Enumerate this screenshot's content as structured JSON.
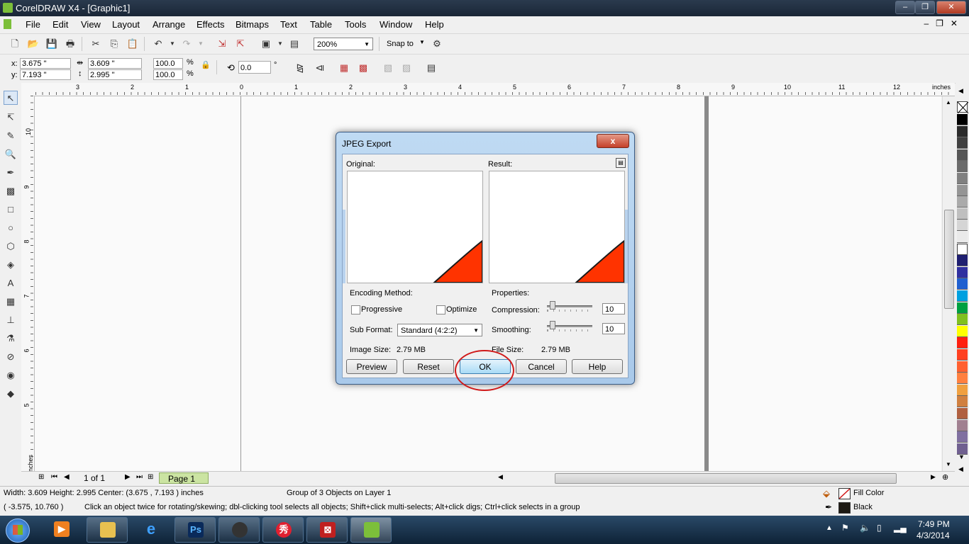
{
  "window": {
    "title": "CorelDRAW X4 - [Graphic1]"
  },
  "menu": [
    "File",
    "Edit",
    "View",
    "Layout",
    "Arrange",
    "Effects",
    "Bitmaps",
    "Text",
    "Table",
    "Tools",
    "Window",
    "Help"
  ],
  "toolbar": {
    "zoom": "200%",
    "snap_to": "Snap to"
  },
  "props": {
    "x_label": "x:",
    "x": "3.675 \"",
    "y_label": "y:",
    "y": "7.193 \"",
    "w": "3.609 \"",
    "h": "2.995 \"",
    "sx": "100.0",
    "sy": "100.0",
    "pct": "%",
    "rotation": "0.0",
    "deg": "°"
  },
  "rulers": {
    "h": [
      "3",
      "2",
      "1",
      "0",
      "1",
      "2",
      "3",
      "4",
      "5",
      "6",
      "7",
      "8",
      "9",
      "10",
      "11",
      "12"
    ],
    "unit": "inches",
    "v": [
      "10",
      "9",
      "8",
      "7",
      "6",
      "5"
    ],
    "v_unit": "inches"
  },
  "page_nav": {
    "count": "1 of 1",
    "tab": "Page 1"
  },
  "dialog": {
    "title": "JPEG Export",
    "close": "x",
    "original": "Original:",
    "result": "Result:",
    "encoding": "Encoding Method:",
    "progressive": "Progressive",
    "optimize": "Optimize",
    "properties": "Properties:",
    "compression": "Compression:",
    "compression_value": "10",
    "smoothing": "Smoothing:",
    "smoothing_value": "10",
    "subformat_label": "Sub Format:",
    "subformat": "Standard (4:2:2)",
    "image_size_label": "Image Size:",
    "image_size": "2.79 MB",
    "file_size_label": "File Size:",
    "file_size": "2.79 MB",
    "buttons": {
      "preview": "Preview",
      "reset": "Reset",
      "ok": "OK",
      "cancel": "Cancel",
      "help": "Help"
    }
  },
  "status": {
    "dimensions": "Width: 3.609  Height: 2.995  Center: (3.675 , 7.193 )  inches",
    "object": "Group of 3 Objects on Layer 1",
    "coords": "( -3.575, 10.760 )",
    "hint": "Click an object twice for rotating/skewing; dbl-clicking tool selects all objects; Shift+click multi-selects; Alt+click digs; Ctrl+click selects in a group",
    "fill": "Fill Color",
    "outline": "Black"
  },
  "taskbar": {
    "time": "7:49 PM",
    "date": "4/3/2014",
    "ps_label": "Ps"
  },
  "colors": {
    "shape_fill": "#ff3300",
    "highlight": "#d01a1a",
    "palette": [
      "#ffffff",
      "#000000",
      "#2b2b2b",
      "#404040",
      "#555555",
      "#6a6a6a",
      "#808080",
      "#959595",
      "#aaaaaa",
      "#bfbfbf",
      "#d5d5d5",
      "#eaeaea",
      "#ffffff",
      "#1f1f70",
      "#3030a0",
      "#2060d0",
      "#00a0e0",
      "#00a040",
      "#80c020",
      "#ffff00",
      "#ff2010",
      "#ff4020",
      "#ff6030",
      "#ff8040",
      "#f0a040",
      "#d08040",
      "#b06040",
      "#a08090",
      "#8070a0",
      "#706090",
      "#605080",
      "#504070"
    ]
  }
}
